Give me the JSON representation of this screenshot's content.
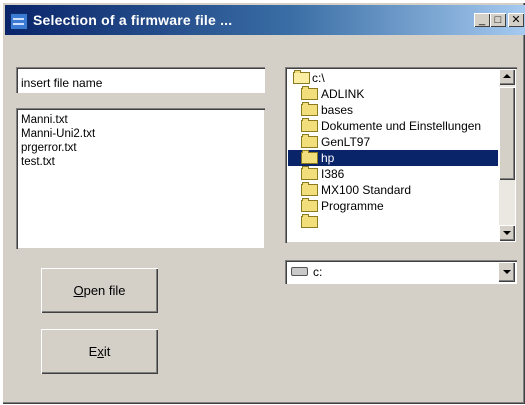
{
  "window": {
    "title": "Selection of a firmware file ...",
    "controls": {
      "minimize": "_",
      "maximize": "□",
      "close": "✕"
    }
  },
  "filename_input": {
    "value": "insert file name"
  },
  "file_list": {
    "items": [
      "Manni.txt",
      "Manni-Uni2.txt",
      "prgerror.txt",
      "test.txt"
    ]
  },
  "directory_list": {
    "items": [
      {
        "label": "c:\\",
        "icon": "open-folder-icon",
        "selected": false
      },
      {
        "label": "ADLINK",
        "icon": "folder-icon",
        "selected": false
      },
      {
        "label": "bases",
        "icon": "folder-icon",
        "selected": false
      },
      {
        "label": "Dokumente und Einstellungen",
        "icon": "folder-icon",
        "selected": false
      },
      {
        "label": "GenLT97",
        "icon": "folder-icon",
        "selected": false
      },
      {
        "label": "hp",
        "icon": "folder-icon",
        "selected": true
      },
      {
        "label": "I386",
        "icon": "folder-icon",
        "selected": false
      },
      {
        "label": "MX100 Standard",
        "icon": "folder-icon",
        "selected": false
      },
      {
        "label": "Programme",
        "icon": "folder-icon",
        "selected": false
      }
    ]
  },
  "drive_select": {
    "value": "c:",
    "icon": "drive-icon"
  },
  "buttons": {
    "open": {
      "before": "",
      "key": "O",
      "after": "pen file"
    },
    "exit": {
      "before": "E",
      "key": "x",
      "after": "it"
    }
  },
  "colors": {
    "titlebar_start": "#0a246a",
    "titlebar_end": "#a6caf0",
    "dialog_face": "#d4d0c8",
    "selection": "#0a246a"
  }
}
